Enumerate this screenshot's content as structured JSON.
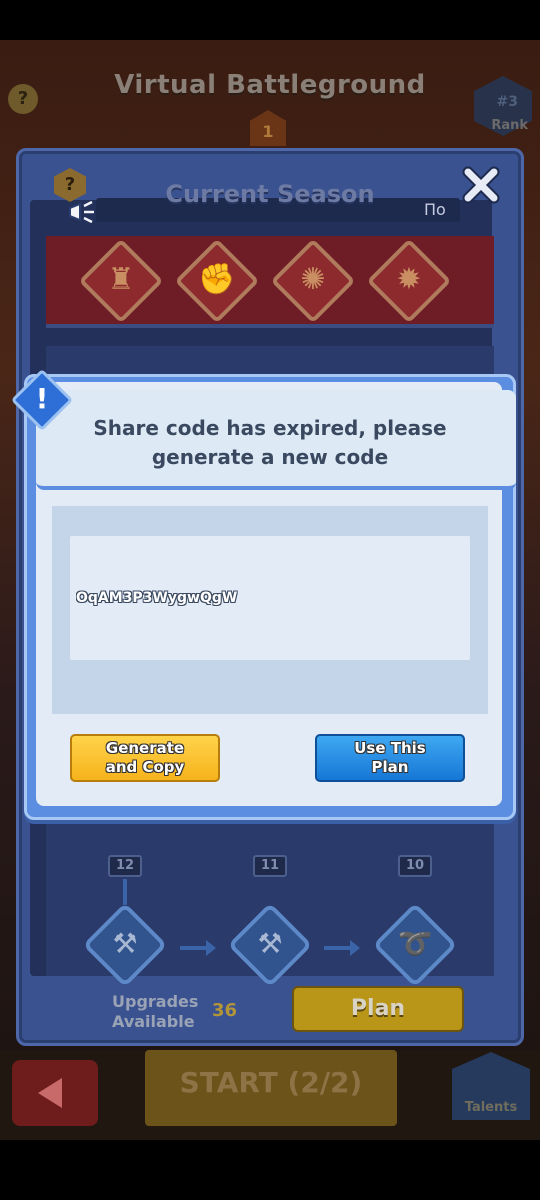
{
  "scene": {
    "title": "Virtual Battleground",
    "help_glyph": "?",
    "rank_number": "#3",
    "rank_label": "Rank",
    "medal_number": "1",
    "start_label": "START (2/2)",
    "talents_label": "Talents"
  },
  "panel": {
    "title": "Current Season",
    "season_badge": "По",
    "help_glyph": "?",
    "close_glyph": "✕",
    "rewards": [
      {
        "icon": "trophy-icon",
        "glyph": "♜"
      },
      {
        "icon": "fist-icon",
        "glyph": "✊"
      },
      {
        "icon": "sun-emblem-icon",
        "glyph": "✺"
      },
      {
        "icon": "gear-emblem-icon",
        "glyph": "✹"
      }
    ],
    "nodes_row_labels": [
      "12",
      "11",
      "10"
    ],
    "bottom_nodes": [
      {
        "icon": "boots-icon",
        "glyph": "⚒"
      },
      {
        "icon": "boots-icon",
        "glyph": "⚒"
      },
      {
        "icon": "dash-icon",
        "glyph": "➰"
      }
    ],
    "upgrades_label": "Upgrades Available",
    "upgrades_count": "36",
    "plan_label": "Plan"
  },
  "dialog": {
    "warning_glyph": "!",
    "message_line1": "Share code has expired, please",
    "message_line2": "generate a new code",
    "code_value": "OqAM3P3WygwQgW",
    "generate_label_line1": "Generate",
    "generate_label_line2": "and Copy",
    "use_plan_label_line1": "Use This",
    "use_plan_label_line2": "Plan"
  }
}
